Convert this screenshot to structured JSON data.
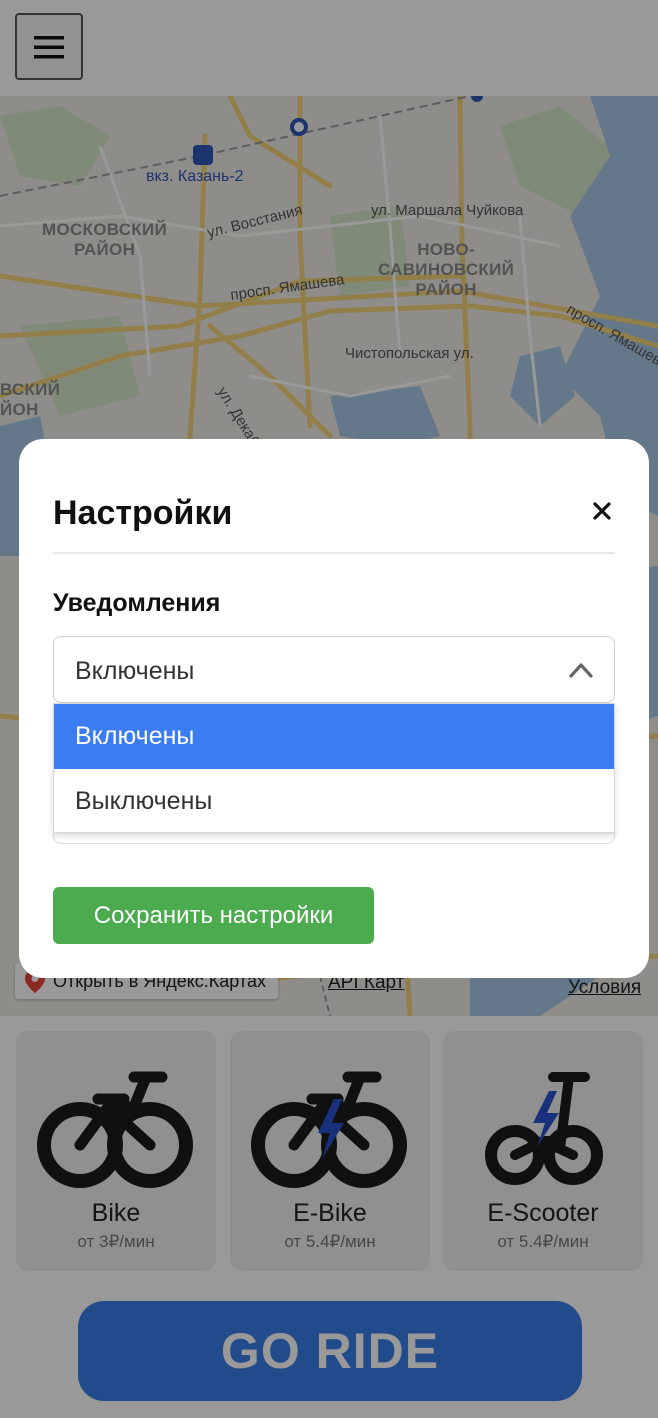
{
  "header": {
    "menu_icon": "hamburger-icon"
  },
  "map": {
    "station": "вкз. Казань-2",
    "streets": [
      "ул. Восстания",
      "ул. Маршала Чуйкова",
      "просп. Ямашева",
      "ул. Декабристов",
      "Чистопольская ул.",
      "просп. Ямашева"
    ],
    "districts": [
      "МОСКОВСКИЙ\nРАЙОН",
      "НОВО-\nСАВИНОВСКИЙ\nРАЙОН",
      "ВСКИЙ\nЙОН"
    ],
    "open_in_yandex": "Открыть в Яндекс.Картах",
    "api_link": "API Карт",
    "terms_link": "Условия"
  },
  "vehicles": [
    {
      "name": "Bike",
      "price": "от 3₽/мин",
      "icon": "bike-icon"
    },
    {
      "name": "E-Bike",
      "price": "от 5.4₽/мин",
      "icon": "ebike-icon"
    },
    {
      "name": "E-Scooter",
      "price": "от 5.4₽/мин",
      "icon": "escooter-icon"
    }
  ],
  "go_button": "GO RIDE",
  "modal": {
    "title": "Настройки",
    "close_icon": "close-icon",
    "notifications_label": "Уведомления",
    "notifications_value": "Включены",
    "options": [
      "Включены",
      "Выключены"
    ],
    "save_button": "Сохранить настройки"
  },
  "colors": {
    "accent_blue": "#3a7de8",
    "selected_option": "#3b7cf0",
    "save_green": "#4caa4f"
  }
}
